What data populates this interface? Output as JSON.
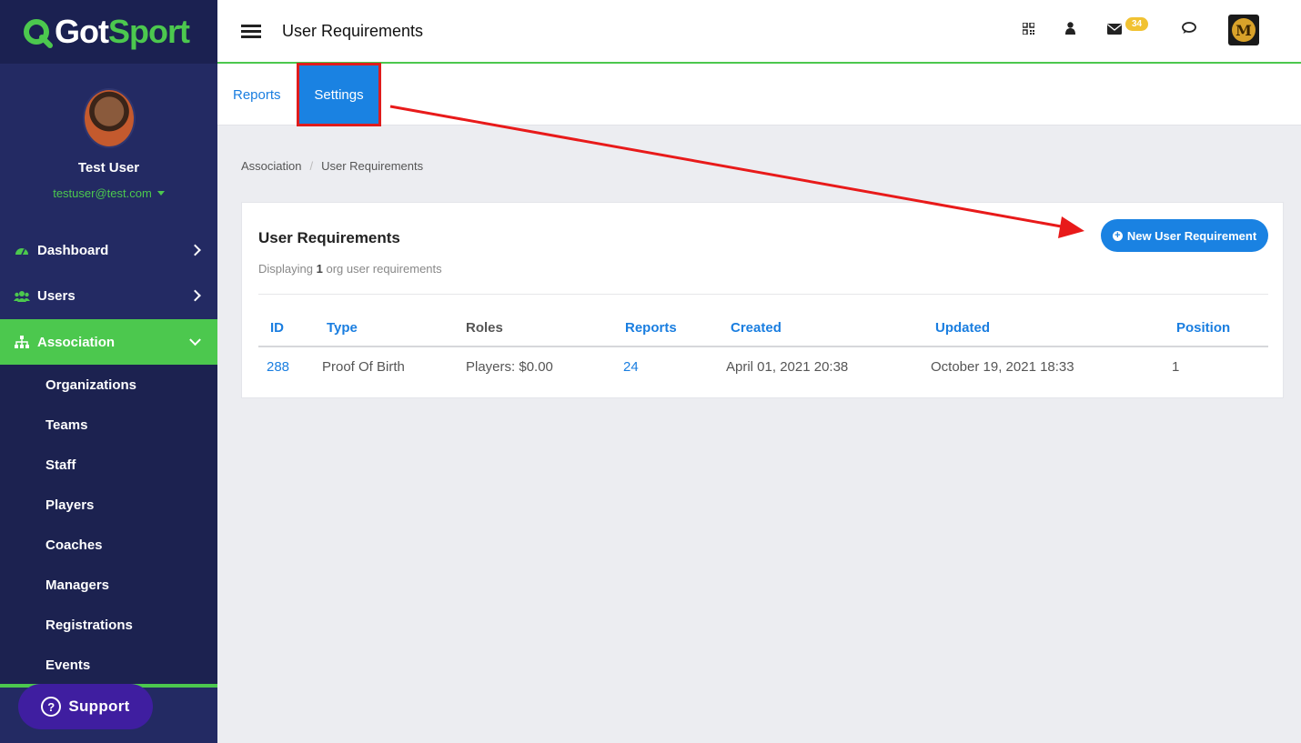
{
  "brand": {
    "logo_got": "Got",
    "logo_sport": "Sport",
    "green": "#4cc84e",
    "navy": "#232a63",
    "blue": "#1a82e2"
  },
  "profile": {
    "name": "Test User",
    "email": "testuser@test.com"
  },
  "sidebar": {
    "items": [
      {
        "label": "Dashboard",
        "icon": "dashboard-icon"
      },
      {
        "label": "Users",
        "icon": "users-icon"
      },
      {
        "label": "Association",
        "icon": "sitemap-icon"
      }
    ],
    "sub_items": [
      "Organizations",
      "Teams",
      "Staff",
      "Players",
      "Coaches",
      "Managers",
      "Registrations",
      "Events"
    ]
  },
  "support": {
    "label": "Support"
  },
  "header": {
    "title": "User Requirements",
    "mail_count": "34",
    "org_logo_letter": "M"
  },
  "tabs": [
    {
      "label": "Reports"
    },
    {
      "label": "Settings"
    }
  ],
  "breadcrumb": [
    "Association",
    "User Requirements"
  ],
  "card": {
    "title": "User Requirements",
    "sub_prefix": "Displaying",
    "count": "1",
    "sub_suffix": "org user requirements",
    "new_button": "New User Requirement"
  },
  "table": {
    "columns": [
      "ID",
      "Type",
      "Roles",
      "Reports",
      "Created",
      "Updated",
      "Position"
    ],
    "rows": [
      {
        "id": "288",
        "type": "Proof Of Birth",
        "roles": "Players: $0.00",
        "reports": "24",
        "created": "April 01, 2021 20:38",
        "updated": "October 19, 2021 18:33",
        "position": "1"
      }
    ]
  }
}
